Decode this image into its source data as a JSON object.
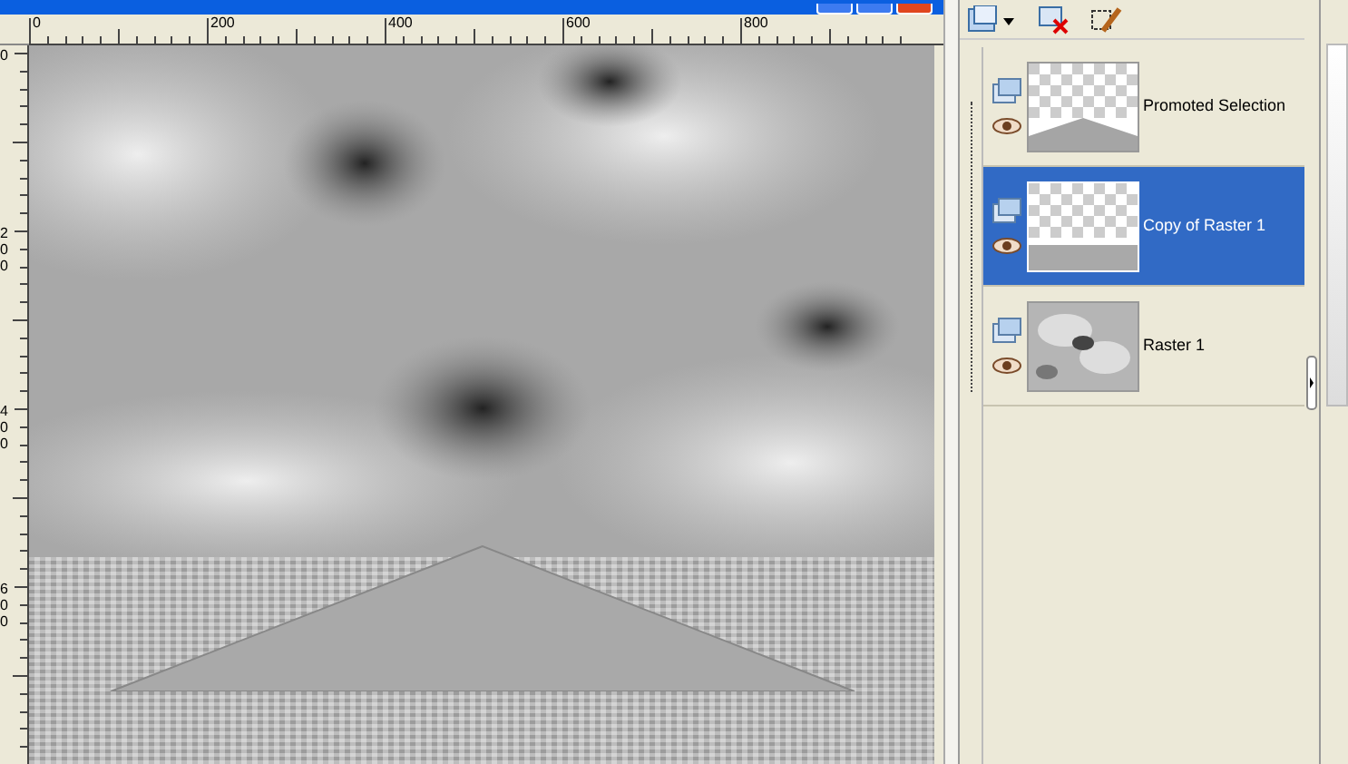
{
  "image_window": {
    "horizontal_ruler": [
      "0",
      "200",
      "400",
      "600",
      "800"
    ],
    "vertical_ruler": [
      "0",
      "200",
      "400",
      "600"
    ]
  },
  "layers_palette": {
    "layers": [
      {
        "name": "Promoted Selection",
        "selected": false,
        "visible": true,
        "kind": "selection"
      },
      {
        "name": "Copy of Raster 1",
        "selected": true,
        "visible": true,
        "kind": "floor"
      },
      {
        "name": "Raster 1",
        "selected": false,
        "visible": true,
        "kind": "clouds"
      }
    ]
  }
}
